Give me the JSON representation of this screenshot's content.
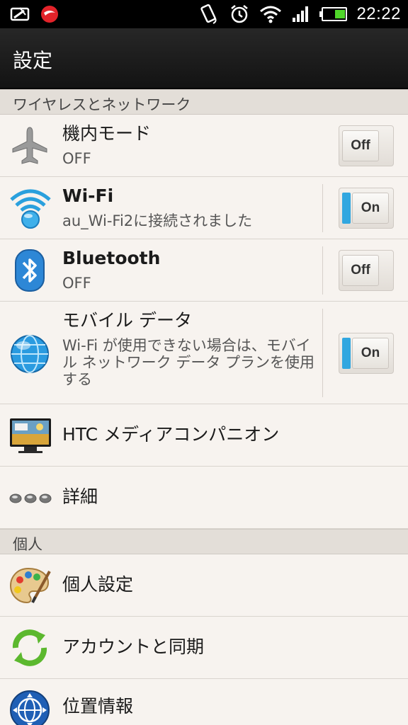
{
  "status_bar": {
    "time": "22:22"
  },
  "title_bar": {
    "title": "設定"
  },
  "sections": {
    "wireless": "ワイヤレスとネットワーク",
    "personal": "個人"
  },
  "rows": {
    "airplane": {
      "label": "機内モード",
      "sub": "OFF",
      "toggle": "Off",
      "icon": "airplane-icon"
    },
    "wifi": {
      "label": "Wi-Fi",
      "sub": "au_Wi-Fi2に接続されました",
      "toggle": "On",
      "icon": "wifi-icon"
    },
    "bluetooth": {
      "label": "Bluetooth",
      "sub": "OFF",
      "toggle": "Off",
      "icon": "bluetooth-icon"
    },
    "mobile_data": {
      "label": "モバイル データ",
      "sub": "Wi-Fi が使用できない場合は、モバイル ネットワーク データ プランを使用する",
      "toggle": "On",
      "icon": "globe-icon"
    },
    "htc_media": {
      "label": "HTC メディアコンパニオン",
      "icon": "tv-icon"
    },
    "details": {
      "label": "詳細",
      "icon": "more-dots-icon"
    },
    "personalize": {
      "label": "個人設定",
      "icon": "palette-icon"
    },
    "accounts": {
      "label": "アカウントと同期",
      "icon": "sync-icon"
    },
    "location": {
      "label": "位置情報",
      "icon": "location-globe-icon"
    }
  },
  "colors": {
    "accent": "#31a7e0",
    "status_bar": "#000000",
    "title_bar": "#1a1a1a",
    "background": "#f7f3ef",
    "section": "#e3ded8"
  }
}
